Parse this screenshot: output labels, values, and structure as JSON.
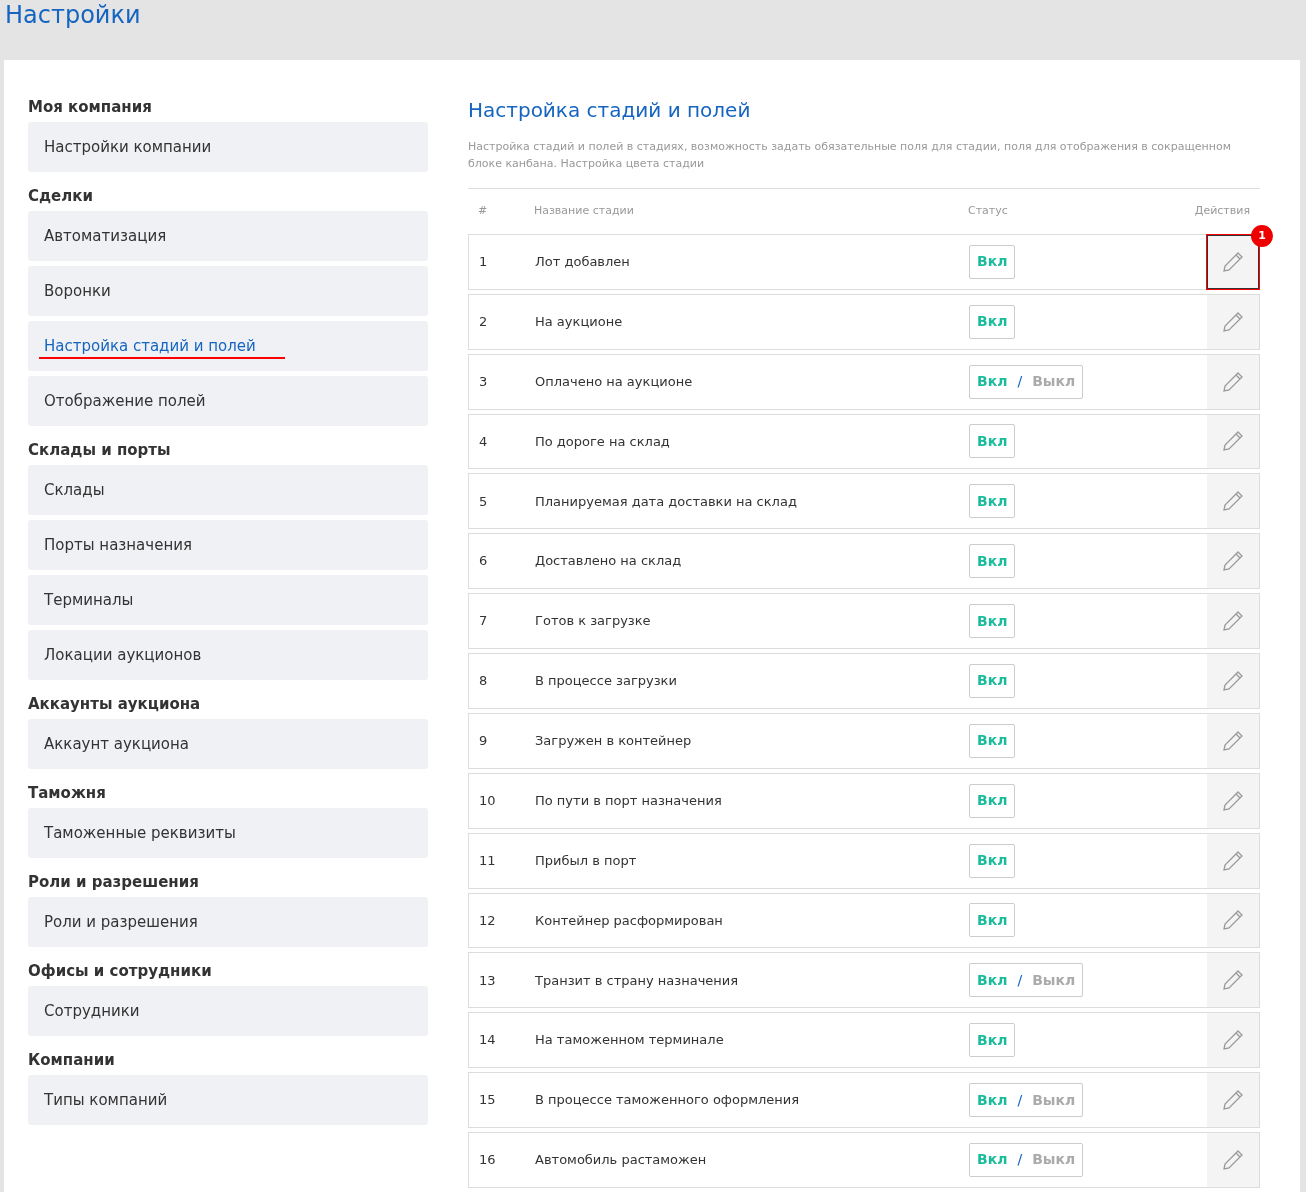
{
  "page_title": "Настройки",
  "sidebar": [
    {
      "heading": "Моя компания",
      "items": [
        {
          "label": "Настройки компании",
          "selected": false
        }
      ]
    },
    {
      "heading": "Сделки",
      "items": [
        {
          "label": "Автоматизация",
          "selected": false
        },
        {
          "label": "Воронки",
          "selected": false
        },
        {
          "label": "Настройка стадий и полей",
          "selected": true
        },
        {
          "label": "Отображение полей",
          "selected": false
        }
      ]
    },
    {
      "heading": "Склады и порты",
      "items": [
        {
          "label": "Склады",
          "selected": false
        },
        {
          "label": "Порты назначения",
          "selected": false
        },
        {
          "label": "Терминалы",
          "selected": false
        },
        {
          "label": "Локации аукционов",
          "selected": false
        }
      ]
    },
    {
      "heading": "Аккаунты аукциона",
      "items": [
        {
          "label": "Аккаунт аукциона",
          "selected": false
        }
      ]
    },
    {
      "heading": "Таможня",
      "items": [
        {
          "label": "Таможенные реквизиты",
          "selected": false
        }
      ]
    },
    {
      "heading": "Роли и разрешения",
      "items": [
        {
          "label": "Роли и разрешения",
          "selected": false
        }
      ]
    },
    {
      "heading": "Офисы и сотрудники",
      "items": [
        {
          "label": "Сотрудники",
          "selected": false
        }
      ]
    },
    {
      "heading": "Компании",
      "items": [
        {
          "label": "Типы компаний",
          "selected": false
        }
      ]
    }
  ],
  "main": {
    "title": "Настройка стадий и полей",
    "description": "Настройка стадий и полей в стадиях, возможность задать обязательные поля для стадии, поля для отображения в сокращенном блоке канбана. Настройка цвета стадии",
    "columns": [
      "#",
      "Название стадии",
      "Статус",
      "Действия"
    ],
    "rows": [
      {
        "num": "1",
        "name": "Лот добавлен",
        "status": {
          "kind": "on",
          "on": "Вкл"
        },
        "highlighted": true,
        "badge": "1"
      },
      {
        "num": "2",
        "name": "На аукционе",
        "status": {
          "kind": "on",
          "on": "Вкл"
        },
        "highlighted": false
      },
      {
        "num": "3",
        "name": "Оплачено на аукционе",
        "status": {
          "kind": "toggle",
          "on": "Вкл",
          "sep": "/",
          "off": "Выкл"
        },
        "highlighted": false
      },
      {
        "num": "4",
        "name": "По дороге на склад",
        "status": {
          "kind": "on",
          "on": "Вкл"
        },
        "highlighted": false
      },
      {
        "num": "5",
        "name": "Планируемая дата доставки на склад",
        "status": {
          "kind": "on",
          "on": "Вкл"
        },
        "highlighted": false
      },
      {
        "num": "6",
        "name": "Доставлено на склад",
        "status": {
          "kind": "on",
          "on": "Вкл"
        },
        "highlighted": false
      },
      {
        "num": "7",
        "name": "Готов к загрузке",
        "status": {
          "kind": "on",
          "on": "Вкл"
        },
        "highlighted": false
      },
      {
        "num": "8",
        "name": "В процессе загрузки",
        "status": {
          "kind": "on",
          "on": "Вкл"
        },
        "highlighted": false
      },
      {
        "num": "9",
        "name": "Загружен в контейнер",
        "status": {
          "kind": "on",
          "on": "Вкл"
        },
        "highlighted": false
      },
      {
        "num": "10",
        "name": "По пути в порт назначения",
        "status": {
          "kind": "on",
          "on": "Вкл"
        },
        "highlighted": false
      },
      {
        "num": "11",
        "name": "Прибыл в порт",
        "status": {
          "kind": "on",
          "on": "Вкл"
        },
        "highlighted": false
      },
      {
        "num": "12",
        "name": "Контейнер расформирован",
        "status": {
          "kind": "on",
          "on": "Вкл"
        },
        "highlighted": false
      },
      {
        "num": "13",
        "name": "Транзит в страну назначения",
        "status": {
          "kind": "toggle",
          "on": "Вкл",
          "sep": "/",
          "off": "Выкл"
        },
        "highlighted": false
      },
      {
        "num": "14",
        "name": "На таможенном терминале",
        "status": {
          "kind": "on",
          "on": "Вкл"
        },
        "highlighted": false
      },
      {
        "num": "15",
        "name": "В процессе таможенного оформления",
        "status": {
          "kind": "toggle",
          "on": "Вкл",
          "sep": "/",
          "off": "Выкл"
        },
        "highlighted": false
      },
      {
        "num": "16",
        "name": "Автомобиль растаможен",
        "status": {
          "kind": "toggle",
          "on": "Вкл",
          "sep": "/",
          "off": "Выкл"
        },
        "highlighted": false
      }
    ]
  }
}
